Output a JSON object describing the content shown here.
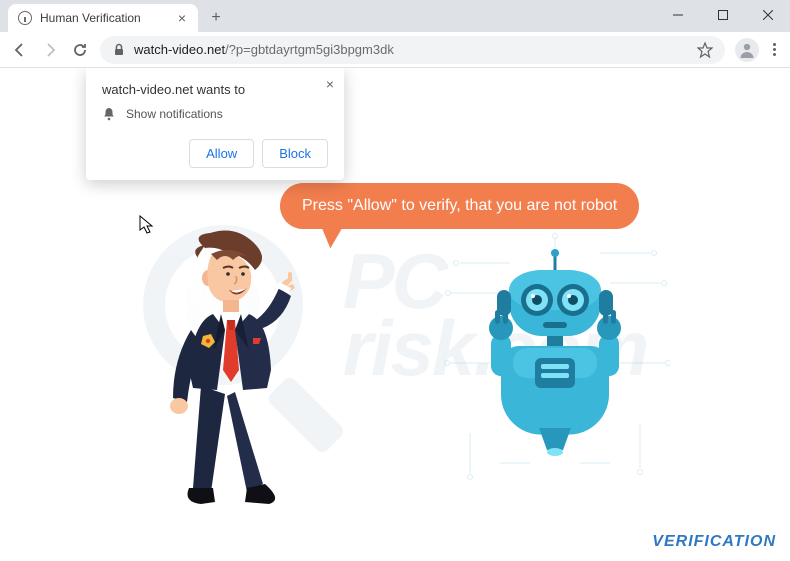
{
  "tab": {
    "title": "Human Verification"
  },
  "url": {
    "host": "watch-video.net",
    "path": "/?p=gbtdayrtgm5gi3bpgm3dk"
  },
  "notification": {
    "title": "watch-video.net wants to",
    "body": "Show notifications",
    "allow": "Allow",
    "block": "Block"
  },
  "bubble": {
    "text": "Press \"Allow\" to verify, that you are not robot"
  },
  "footer": {
    "verification": "VERIFICATION"
  },
  "colors": {
    "accent": "#f27e4e",
    "link": "#1a73e8",
    "robot": "#2ba3c9",
    "verification": "#2f78c2"
  }
}
